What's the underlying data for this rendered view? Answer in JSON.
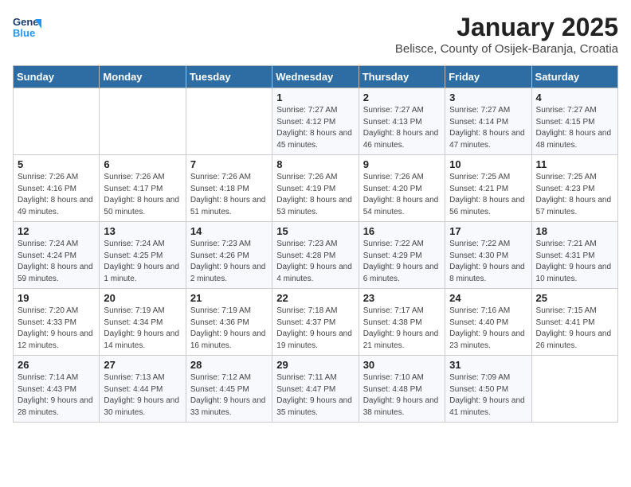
{
  "logo": {
    "line1": "General",
    "line2": "Blue"
  },
  "title": "January 2025",
  "subtitle": "Belisce, County of Osijek-Baranja, Croatia",
  "weekdays": [
    "Sunday",
    "Monday",
    "Tuesday",
    "Wednesday",
    "Thursday",
    "Friday",
    "Saturday"
  ],
  "weeks": [
    [
      null,
      null,
      null,
      {
        "day": "1",
        "sunrise": "7:27 AM",
        "sunset": "4:12 PM",
        "daylight": "8 hours and 45 minutes."
      },
      {
        "day": "2",
        "sunrise": "7:27 AM",
        "sunset": "4:13 PM",
        "daylight": "8 hours and 46 minutes."
      },
      {
        "day": "3",
        "sunrise": "7:27 AM",
        "sunset": "4:14 PM",
        "daylight": "8 hours and 47 minutes."
      },
      {
        "day": "4",
        "sunrise": "7:27 AM",
        "sunset": "4:15 PM",
        "daylight": "8 hours and 48 minutes."
      }
    ],
    [
      {
        "day": "5",
        "sunrise": "7:26 AM",
        "sunset": "4:16 PM",
        "daylight": "8 hours and 49 minutes."
      },
      {
        "day": "6",
        "sunrise": "7:26 AM",
        "sunset": "4:17 PM",
        "daylight": "8 hours and 50 minutes."
      },
      {
        "day": "7",
        "sunrise": "7:26 AM",
        "sunset": "4:18 PM",
        "daylight": "8 hours and 51 minutes."
      },
      {
        "day": "8",
        "sunrise": "7:26 AM",
        "sunset": "4:19 PM",
        "daylight": "8 hours and 53 minutes."
      },
      {
        "day": "9",
        "sunrise": "7:26 AM",
        "sunset": "4:20 PM",
        "daylight": "8 hours and 54 minutes."
      },
      {
        "day": "10",
        "sunrise": "7:25 AM",
        "sunset": "4:21 PM",
        "daylight": "8 hours and 56 minutes."
      },
      {
        "day": "11",
        "sunrise": "7:25 AM",
        "sunset": "4:23 PM",
        "daylight": "8 hours and 57 minutes."
      }
    ],
    [
      {
        "day": "12",
        "sunrise": "7:24 AM",
        "sunset": "4:24 PM",
        "daylight": "8 hours and 59 minutes."
      },
      {
        "day": "13",
        "sunrise": "7:24 AM",
        "sunset": "4:25 PM",
        "daylight": "9 hours and 1 minute."
      },
      {
        "day": "14",
        "sunrise": "7:23 AM",
        "sunset": "4:26 PM",
        "daylight": "9 hours and 2 minutes."
      },
      {
        "day": "15",
        "sunrise": "7:23 AM",
        "sunset": "4:28 PM",
        "daylight": "9 hours and 4 minutes."
      },
      {
        "day": "16",
        "sunrise": "7:22 AM",
        "sunset": "4:29 PM",
        "daylight": "9 hours and 6 minutes."
      },
      {
        "day": "17",
        "sunrise": "7:22 AM",
        "sunset": "4:30 PM",
        "daylight": "9 hours and 8 minutes."
      },
      {
        "day": "18",
        "sunrise": "7:21 AM",
        "sunset": "4:31 PM",
        "daylight": "9 hours and 10 minutes."
      }
    ],
    [
      {
        "day": "19",
        "sunrise": "7:20 AM",
        "sunset": "4:33 PM",
        "daylight": "9 hours and 12 minutes."
      },
      {
        "day": "20",
        "sunrise": "7:19 AM",
        "sunset": "4:34 PM",
        "daylight": "9 hours and 14 minutes."
      },
      {
        "day": "21",
        "sunrise": "7:19 AM",
        "sunset": "4:36 PM",
        "daylight": "9 hours and 16 minutes."
      },
      {
        "day": "22",
        "sunrise": "7:18 AM",
        "sunset": "4:37 PM",
        "daylight": "9 hours and 19 minutes."
      },
      {
        "day": "23",
        "sunrise": "7:17 AM",
        "sunset": "4:38 PM",
        "daylight": "9 hours and 21 minutes."
      },
      {
        "day": "24",
        "sunrise": "7:16 AM",
        "sunset": "4:40 PM",
        "daylight": "9 hours and 23 minutes."
      },
      {
        "day": "25",
        "sunrise": "7:15 AM",
        "sunset": "4:41 PM",
        "daylight": "9 hours and 26 minutes."
      }
    ],
    [
      {
        "day": "26",
        "sunrise": "7:14 AM",
        "sunset": "4:43 PM",
        "daylight": "9 hours and 28 minutes."
      },
      {
        "day": "27",
        "sunrise": "7:13 AM",
        "sunset": "4:44 PM",
        "daylight": "9 hours and 30 minutes."
      },
      {
        "day": "28",
        "sunrise": "7:12 AM",
        "sunset": "4:45 PM",
        "daylight": "9 hours and 33 minutes."
      },
      {
        "day": "29",
        "sunrise": "7:11 AM",
        "sunset": "4:47 PM",
        "daylight": "9 hours and 35 minutes."
      },
      {
        "day": "30",
        "sunrise": "7:10 AM",
        "sunset": "4:48 PM",
        "daylight": "9 hours and 38 minutes."
      },
      {
        "day": "31",
        "sunrise": "7:09 AM",
        "sunset": "4:50 PM",
        "daylight": "9 hours and 41 minutes."
      },
      null
    ]
  ]
}
